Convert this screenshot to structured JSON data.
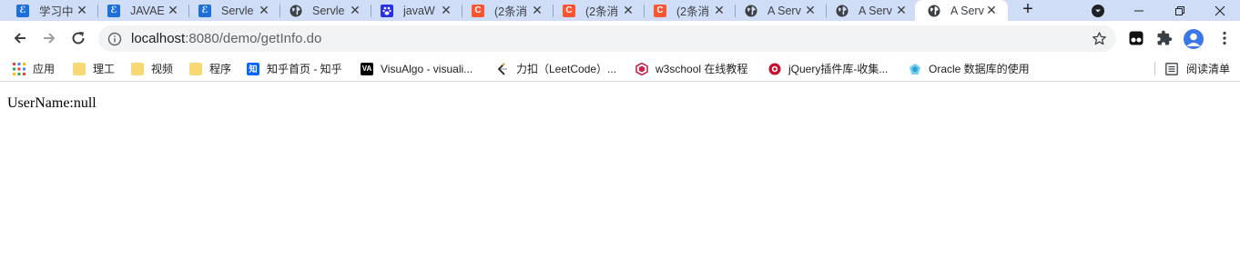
{
  "tabs": [
    {
      "title": "学习中",
      "favicon": "blue-square-icon",
      "active": false
    },
    {
      "title": "JAVAE",
      "favicon": "blue-square-icon",
      "active": false
    },
    {
      "title": "Servle",
      "favicon": "blue-square-icon",
      "active": false
    },
    {
      "title": "Servle",
      "favicon": "globe-icon",
      "active": false
    },
    {
      "title": "javaW",
      "favicon": "baidu-icon",
      "active": false
    },
    {
      "title": "(2条消",
      "favicon": "csdn-icon",
      "active": false
    },
    {
      "title": "(2条消",
      "favicon": "csdn-icon",
      "active": false
    },
    {
      "title": "(2条消",
      "favicon": "csdn-icon",
      "active": false
    },
    {
      "title": "A Serv",
      "favicon": "globe-icon",
      "active": false
    },
    {
      "title": "A Serv",
      "favicon": "globe-icon",
      "active": false
    },
    {
      "title": "A Serv",
      "favicon": "globe-icon",
      "active": true
    }
  ],
  "omnibox": {
    "host": "localhost",
    "path": ":8080/demo/getInfo.do"
  },
  "bookmarks": [
    {
      "label": "应用",
      "icon": "apps-grid-icon"
    },
    {
      "label": "理工",
      "icon": "folder-icon"
    },
    {
      "label": "视频",
      "icon": "folder-icon"
    },
    {
      "label": "程序",
      "icon": "folder-icon"
    },
    {
      "label": "知乎首页 - 知乎",
      "icon": "zhihu-icon",
      "glyph": "知"
    },
    {
      "label": "VisuAlgo - visuali...",
      "icon": "visualgo-icon",
      "glyph": "VA"
    },
    {
      "label": "力扣（LeetCode）...",
      "icon": "leetcode-icon"
    },
    {
      "label": "w3school 在线教程",
      "icon": "w3school-icon"
    },
    {
      "label": "jQuery插件库-收集...",
      "icon": "jquery-icon"
    },
    {
      "label": "Oracle 数据库的使用",
      "icon": "oracle-icon"
    }
  ],
  "reading_list": "阅读清单",
  "page": {
    "text": "UserName:null"
  },
  "colors": {
    "tabstrip": "#cfddf6",
    "accent": "#3b78e7"
  }
}
